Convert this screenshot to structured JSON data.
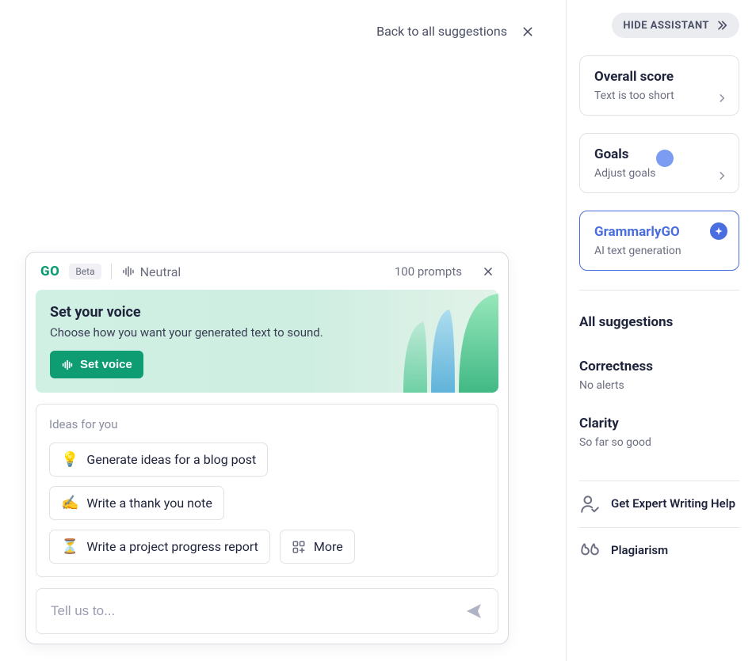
{
  "main": {
    "back_label": "Back to all suggestions",
    "panel": {
      "logo": "GO",
      "beta": "Beta",
      "voice": "Neutral",
      "prompts": "100 prompts",
      "banner": {
        "title": "Set your voice",
        "desc": "Choose how you want your generated text to sound.",
        "button": "Set voice"
      },
      "ideas_label": "Ideas for you",
      "ideas": [
        {
          "emoji": "💡",
          "label": "Generate ideas for a blog post"
        },
        {
          "emoji": "✍️",
          "label": "Write a thank you note"
        },
        {
          "emoji": "⏳",
          "label": "Write a project progress report"
        }
      ],
      "more": "More",
      "input_placeholder": "Tell us to..."
    }
  },
  "sidebar": {
    "hide": "HIDE ASSISTANT",
    "cards": [
      {
        "title": "Overall score",
        "subtitle": "Text is too short"
      },
      {
        "title": "Goals",
        "subtitle": "Adjust goals"
      },
      {
        "title": "GrammarlyGO",
        "subtitle": "AI text generation"
      }
    ],
    "sections": [
      {
        "title": "All suggestions",
        "sub": ""
      },
      {
        "title": "Correctness",
        "sub": "No alerts"
      },
      {
        "title": "Clarity",
        "sub": "So far so good"
      }
    ],
    "footer": [
      {
        "label": "Get Expert Writing Help"
      },
      {
        "label": "Plagiarism"
      }
    ]
  }
}
